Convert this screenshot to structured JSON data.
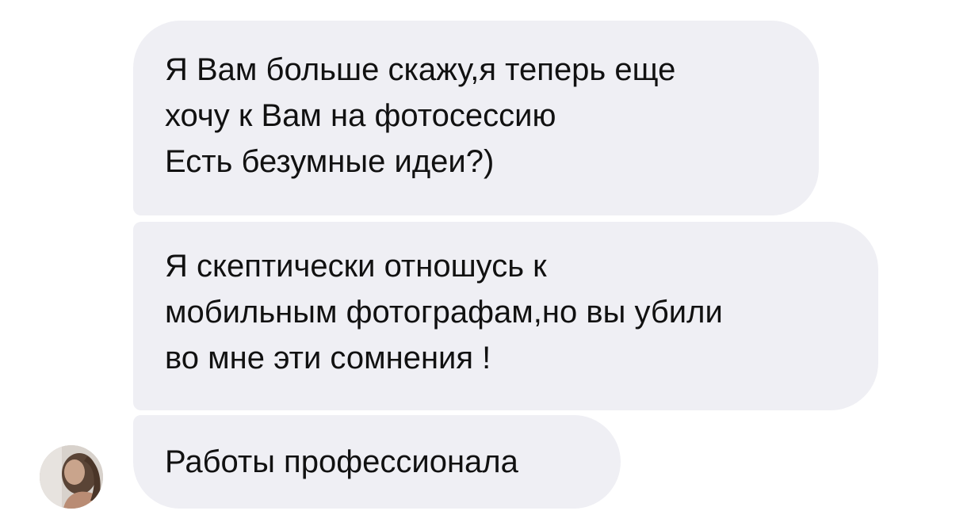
{
  "conversation": {
    "messages": [
      {
        "lines": [
          "Я Вам больше скажу,я теперь еще",
          "хочу к Вам на фотосессию",
          "Есть безумные идеи?)"
        ]
      },
      {
        "lines": [
          "Я скептически отношусь к",
          "мобильным фотографам,но вы убили",
          "во мне эти сомнения !"
        ]
      },
      {
        "lines": [
          "Работы профессионала"
        ]
      }
    ],
    "avatar_icon": "user-photo-avatar",
    "bubble_color": "#efeff4",
    "text_color": "#111111"
  }
}
